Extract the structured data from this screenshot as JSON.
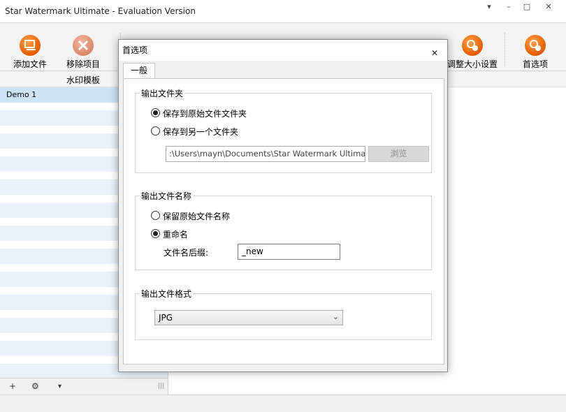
{
  "app": {
    "title": "Star Watermark Ultimate - Evaluation Version",
    "window_controls": {
      "pin": "▾",
      "minimize": "–",
      "maximize": "□",
      "close": "✕"
    }
  },
  "toolbar": {
    "add_file": {
      "label": "添加文件",
      "icon": "add-file-icon"
    },
    "remove_item": {
      "label": "移除项目",
      "icon": "remove-icon"
    },
    "resize_settings": {
      "label": "调整大小设置",
      "icon": "gear-icon"
    },
    "preferences": {
      "label": "首选项",
      "icon": "gear-icon"
    }
  },
  "list": {
    "column_header": "水印模板",
    "items": [
      "Demo 1"
    ]
  },
  "bottom_bar": {
    "add": "+",
    "settings": "⚙",
    "dropdown": "▾",
    "grip": "|||"
  },
  "dialog": {
    "title": "首选项",
    "close": "✕",
    "tab": "一般",
    "output_folder": {
      "title": "输出文件夹",
      "option_original": "保存到原始文件文件夹",
      "option_other": "保存到另一个文件夹",
      "selected": "original",
      "path": ":\\Users\\mayn\\Documents\\Star Watermark Ultimate",
      "browse": "浏览"
    },
    "output_name": {
      "title": "输出文件名称",
      "option_keep": "保留原始文件名称",
      "option_rename": "重命名",
      "selected": "rename",
      "suffix_label": "文件名后缀:",
      "suffix_value": "_new"
    },
    "output_format": {
      "title": "输出文件格式",
      "selected": "JPG"
    }
  },
  "colors": {
    "accent_orange": "#f26a10",
    "list_selected": "#cce4f7",
    "list_stripe": "#e8f0fa"
  }
}
